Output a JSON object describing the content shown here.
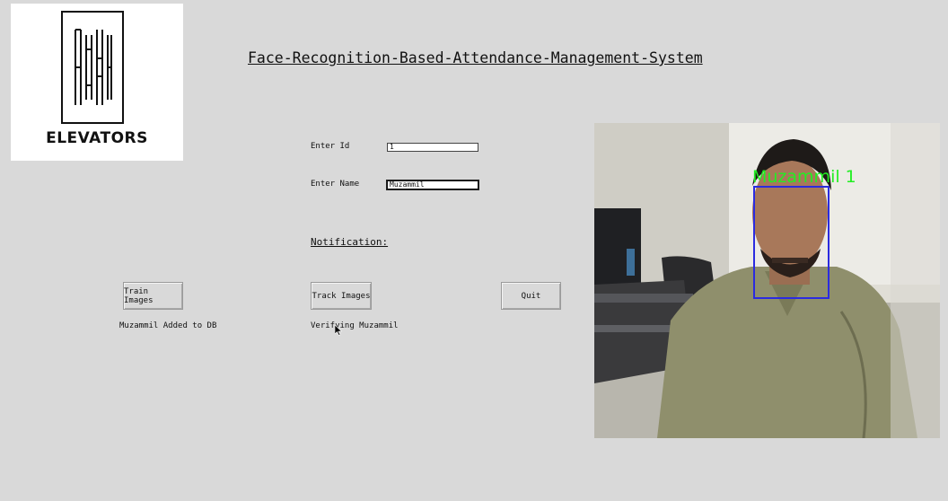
{
  "logo": {
    "wordmark": "ELEVATORS"
  },
  "app": {
    "title": "Face-Recognition-Based-Attendance-Management-System"
  },
  "form": {
    "id_label": "Enter Id",
    "id_value": "1",
    "name_label": "Enter Name",
    "name_value": "Muzammil"
  },
  "notification": {
    "label": "Notification:"
  },
  "buttons": {
    "train": "Train Images",
    "track": "Track Images",
    "quit": "Quit"
  },
  "messages": {
    "train_status": "Muzammil Added to DB",
    "track_status": "Verifying Muzammil"
  },
  "camera": {
    "detection_label": "Muzammil 1",
    "box_color": "#2b2be0",
    "label_color": "#22ee22"
  }
}
